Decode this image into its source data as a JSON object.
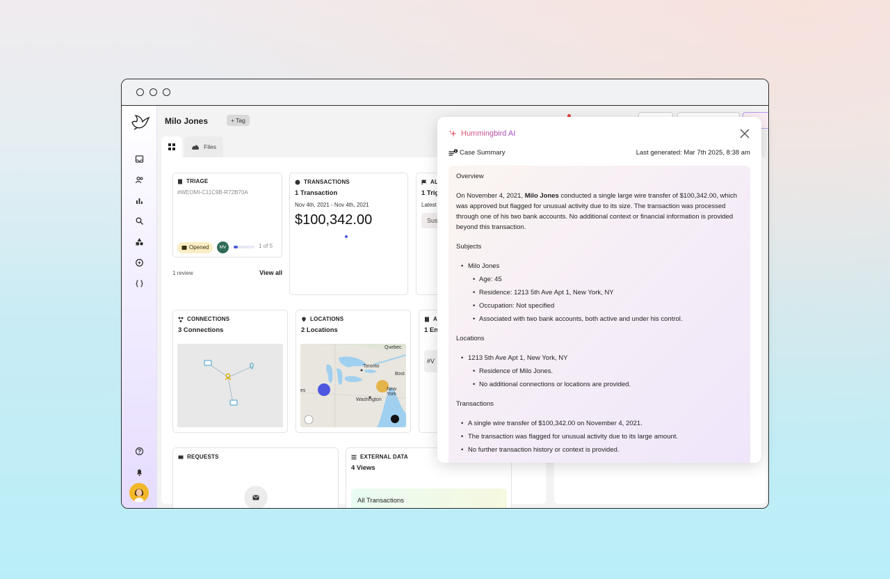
{
  "header": {
    "name": "Milo Jones",
    "tag_label": "+ Tag"
  },
  "tabs": {
    "files_label": "Files"
  },
  "triage": {
    "title": "TRIAGE",
    "case_id": "#WEOMI-C11C9B-R72B70A",
    "status": "Opened",
    "assignee_initials": "MV",
    "progress_fraction": 0.2,
    "progress_text": "1 of 5",
    "reviews": "1 review",
    "view_all": "View all"
  },
  "transactions": {
    "title": "TRANSACTIONS",
    "count": "1 Transaction",
    "date_range": "Nov 4th, 2021 - Nov 4th, 2021",
    "amount": "$100,342.00"
  },
  "alerts": {
    "title": "AL",
    "count": "1 Trig",
    "latest": "Latest",
    "status": "Sus"
  },
  "connections": {
    "title": "CONNECTIONS",
    "count": "3 Connections"
  },
  "locations": {
    "title": "LOCATIONS",
    "count": "2 Locations",
    "map_labels": {
      "quebec": "Quebec",
      "toronto": "Toronto",
      "boston": "Bost",
      "new_york": "New York",
      "washington": "Washington",
      "west": "es"
    }
  },
  "entities": {
    "title": "A",
    "count": "1 Ent",
    "chip": "#V"
  },
  "requests": {
    "title": "REQUESTS"
  },
  "external": {
    "title": "EXTERNAL DATA",
    "count": "4 Views",
    "view_name": "All Transactions"
  },
  "ai_panel": {
    "title": "Hummingbird AI",
    "case_summary_label": "Case Summary",
    "last_generated": "Last generated: Mar 7th 2025, 8:38 am",
    "overview_heading": "Overview",
    "overview_pre": "On November 4, 2021, ",
    "overview_name": "Milo Jones",
    "overview_post": " conducted a single large wire transfer of $100,342.00, which was approved but flagged for unusual activity due to its size. The transaction was processed through one of his two bank accounts. No additional context or financial information is provided beyond this transaction.",
    "subjects_heading": "Subjects",
    "subject_name": "Milo Jones",
    "subject_details": [
      "Age: 45",
      "Residence: 1213 5th Ave Apt 1, New York, NY",
      "Occupation: Not specified",
      "Associated with two bank accounts, both active and under his control."
    ],
    "locations_heading": "Locations",
    "location_name": "1213 5th Ave Apt 1, New York, NY",
    "location_details": [
      "Residence of Milo Jones.",
      "No additional connections or locations are provided."
    ],
    "transactions_heading": "Transactions",
    "transaction_items": [
      "A single wire transfer of $100,342.00 on November 4, 2021.",
      "The transaction was flagged for unusual activity due to its large amount.",
      "No further transaction history or context is provided."
    ]
  }
}
